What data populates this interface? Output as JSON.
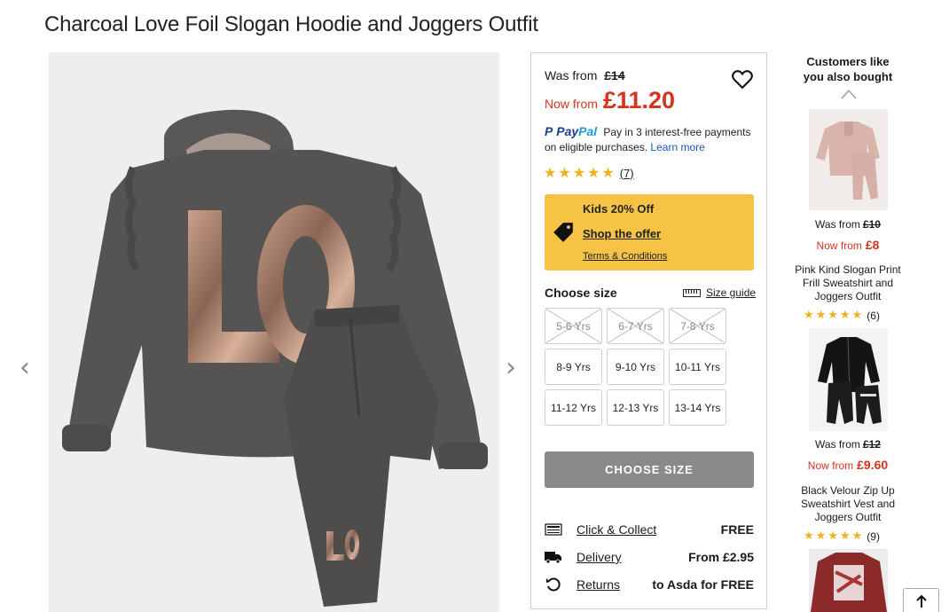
{
  "product": {
    "title": "Charcoal Love Foil Slogan Hoodie and Joggers Outfit",
    "was_label": "Was from",
    "was_price": "£14",
    "now_label": "Now from",
    "now_price": "£11.20",
    "paypal": {
      "logo_p": "Pay",
      "logo_pal": "Pal",
      "text": "Pay in 3 interest-free payments on eligible purchases.",
      "link": "Learn more"
    },
    "rating": {
      "stars": 5,
      "count": "(7)"
    },
    "offer": {
      "title": "Kids 20% Off",
      "shop": "Shop the offer",
      "terms": "Terms & Conditions"
    },
    "size": {
      "heading": "Choose size",
      "guide": "Size guide",
      "options": [
        {
          "label": "5-6 Yrs",
          "available": false
        },
        {
          "label": "6-7 Yrs",
          "available": false
        },
        {
          "label": "7-8 Yrs",
          "available": false
        },
        {
          "label": "8-9 Yrs",
          "available": true
        },
        {
          "label": "9-10 Yrs",
          "available": true
        },
        {
          "label": "10-11 Yrs",
          "available": true
        },
        {
          "label": "11-12 Yrs",
          "available": true
        },
        {
          "label": "12-13 Yrs",
          "available": true
        },
        {
          "label": "13-14 Yrs",
          "available": true
        }
      ]
    },
    "cta": "CHOOSE SIZE",
    "delivery": [
      {
        "icon": "click-collect-icon",
        "label": "Click & Collect",
        "value": "FREE"
      },
      {
        "icon": "truck-icon",
        "label": "Delivery",
        "value": "From £2.95"
      },
      {
        "icon": "returns-icon",
        "label": "Returns",
        "value": "to Asda for FREE"
      }
    ]
  },
  "recommendations": {
    "title": "Customers like you also bought",
    "items": [
      {
        "was_label": "Was from",
        "was": "£10",
        "now_label": "Now from",
        "now": "£8",
        "name": "Pink Kind Slogan Print Frill Sweatshirt and Joggers Outfit",
        "stars": 5,
        "count": "(6)"
      },
      {
        "was_label": "Was from",
        "was": "£12",
        "now_label": "Now from",
        "now": "£9.60",
        "name": "Black Velour Zip Up Sweatshirt Vest and Joggers Outfit",
        "stars": 5,
        "count": "(9)"
      }
    ]
  },
  "colors": {
    "price_red": "#d6331d",
    "offer_yellow": "#f6c344",
    "star_gold": "#f2b01e",
    "cta_grey": "#8a8a8a"
  }
}
